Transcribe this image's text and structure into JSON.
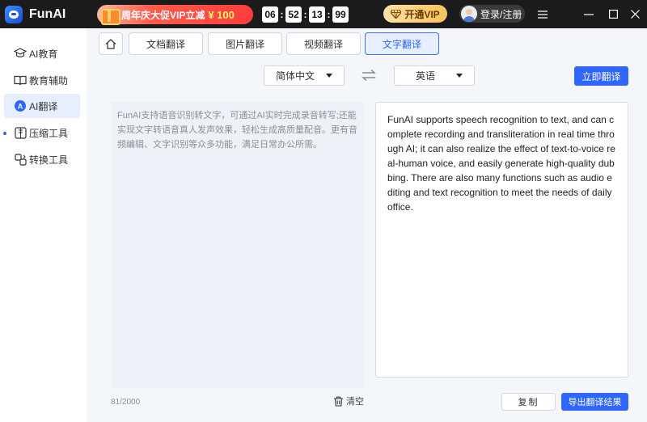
{
  "app": {
    "name": "FunAI"
  },
  "promo": {
    "text": "周年庆大促VIP立减",
    "price": "¥ 100"
  },
  "countdown": [
    "06",
    "52",
    "13",
    "99"
  ],
  "header": {
    "vip_label": "开通VIP",
    "login_label": "登录/注册"
  },
  "sidebar": {
    "items": [
      {
        "label": "AI教育",
        "icon": "graduation-cap-icon"
      },
      {
        "label": "教育辅助",
        "icon": "book-icon"
      },
      {
        "label": "AI翻译",
        "icon": "translate-icon",
        "active": true
      },
      {
        "label": "压缩工具",
        "icon": "compress-icon"
      },
      {
        "label": "转换工具",
        "icon": "convert-icon"
      }
    ]
  },
  "tabs": [
    {
      "label": "文档翻译"
    },
    {
      "label": "图片翻译"
    },
    {
      "label": "视频翻译"
    },
    {
      "label": "文字翻译",
      "active": true
    }
  ],
  "translator": {
    "source_lang": "简体中文",
    "target_lang": "英语",
    "translate_label": "立即翻译",
    "source_text": "FunAI支持语音识别转文字，可通过AI实时完成录音转写;还能实现文字转语音真人发声效果，轻松生成高质量配音。更有音频编辑、文字识别等众多功能，满足日常办公所需。",
    "result_text": "FunAI supports speech recognition to text, and can complete recording and transliteration in real time through AI; it can also realize the effect of text-to-voice real-human voice, and easily generate high-quality dubbing. There are also many functions such as audio editing and text recognition to meet the needs of daily office.",
    "char_count": "81/2000",
    "clear_label": "清空",
    "copy_label": "复制",
    "export_label": "导出翻译结果"
  },
  "colors": {
    "accent": "#2f66ff",
    "titlebar": "#1b1b1b",
    "promo": "#ff3d3d",
    "vip": "#f7c25a"
  }
}
